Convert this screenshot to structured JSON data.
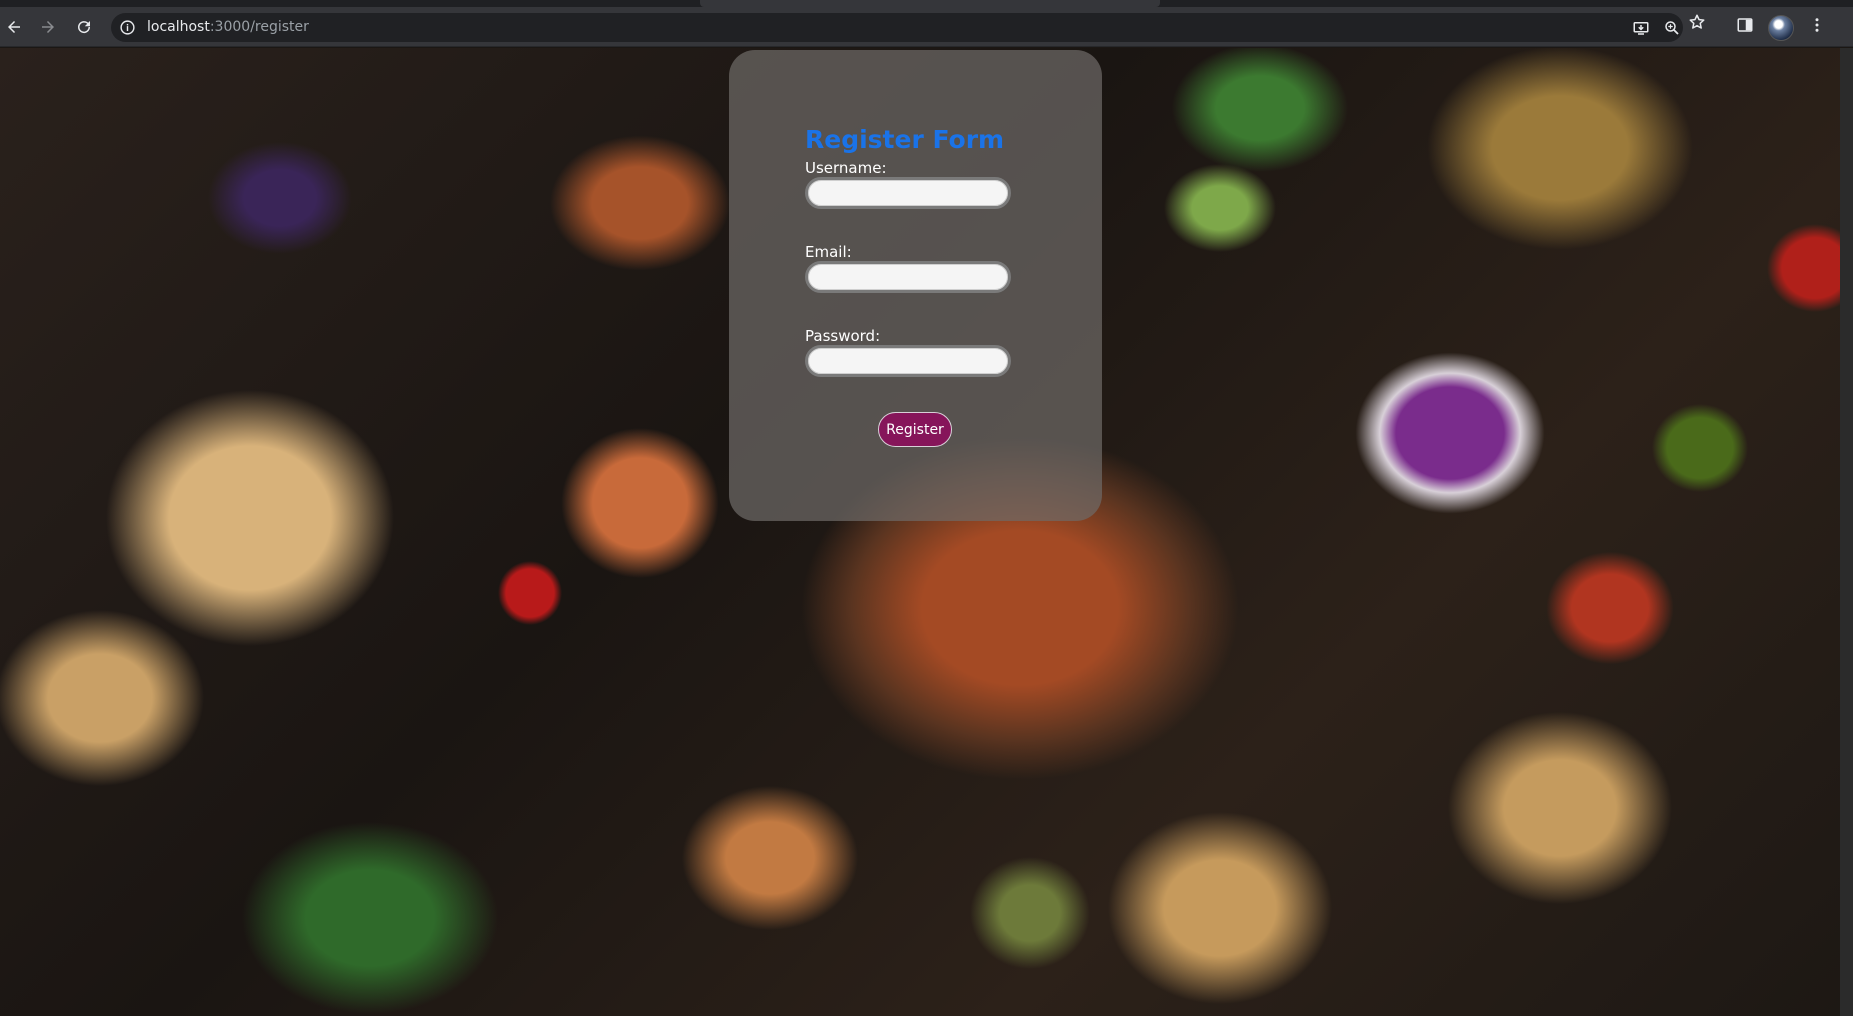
{
  "browser": {
    "url_host": "localhost",
    "url_path": ":3000/register"
  },
  "icons": {
    "back": "back-arrow-icon",
    "forward": "forward-arrow-icon",
    "reload": "reload-icon",
    "site_info": "info-icon",
    "install": "install-app-icon",
    "zoom": "zoom-icon",
    "bookmark": "star-icon",
    "side_panel": "side-panel-icon",
    "profile": "avatar",
    "menu": "kebab-menu-icon"
  },
  "form": {
    "title": "Register Form",
    "username_label": "Username:",
    "username_value": "",
    "email_label": "Email:",
    "email_value": "",
    "password_label": "Password:",
    "password_value": "",
    "submit_label": "Register"
  },
  "colors": {
    "title": "#1a73e8",
    "button_bg": "#86155a",
    "card_bg": "rgba(110,105,102,0.72)",
    "chrome_bg": "#35363a",
    "omnibox_bg": "#202124"
  }
}
